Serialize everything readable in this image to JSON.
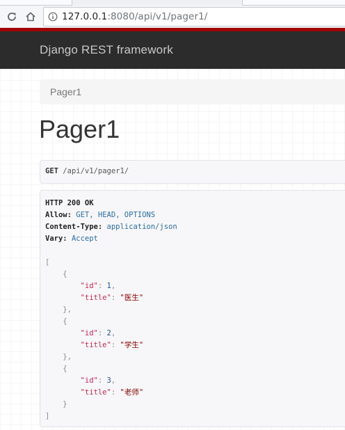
{
  "browser": {
    "url_host": "127.0.0.1",
    "url_rest": ":8080/api/v1/pager1/"
  },
  "app": {
    "brand": "Django REST framework"
  },
  "breadcrumb": {
    "item": "Pager1"
  },
  "page": {
    "title": "Pager1"
  },
  "request": {
    "method": "GET",
    "path": "/api/v1/pager1/"
  },
  "response": {
    "status_line": "HTTP 200 OK",
    "headers": [
      {
        "key": "Allow",
        "value": "GET, HEAD, OPTIONS"
      },
      {
        "key": "Content-Type",
        "value": "application/json"
      },
      {
        "key": "Vary",
        "value": "Accept"
      }
    ],
    "body": [
      {
        "id_key": "\"id\"",
        "id": "1",
        "title_key": "\"title\"",
        "title": "\"医生\""
      },
      {
        "id_key": "\"id\"",
        "id": "2",
        "title_key": "\"title\"",
        "title": "\"学生\""
      },
      {
        "id_key": "\"id\"",
        "id": "3",
        "title_key": "\"title\"",
        "title": "\"老师\""
      }
    ]
  },
  "colors": {
    "navbar": "#2c2c2c",
    "navbar_accent": "#a30000",
    "json_key": "#c7254e",
    "json_string": "#880000",
    "json_number": "#1a4f9c",
    "header_value": "#2a6ca3"
  }
}
